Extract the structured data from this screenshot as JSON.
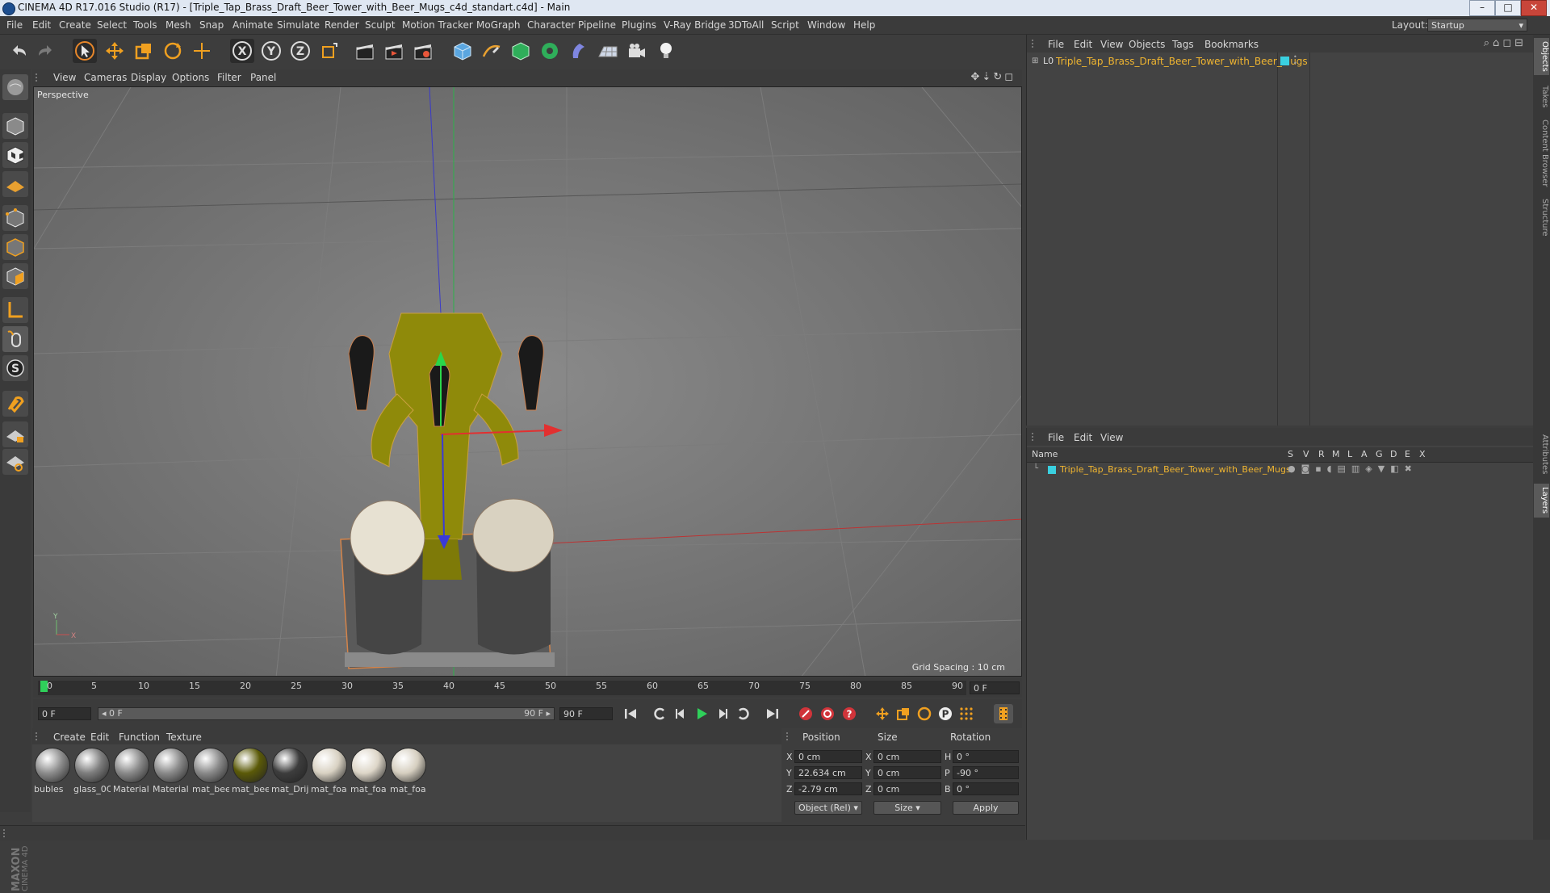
{
  "window": {
    "title": "CINEMA 4D R17.016 Studio (R17) - [Triple_Tap_Brass_Draft_Beer_Tower_with_Beer_Mugs_c4d_standart.c4d] - Main",
    "minimize": "–",
    "maximize": "□",
    "close": "✕"
  },
  "menubar": {
    "items": [
      "File",
      "Edit",
      "Create",
      "Select",
      "Tools",
      "Mesh",
      "Snap",
      "Animate",
      "Simulate",
      "Render",
      "Sculpt",
      "Motion Tracker",
      "MoGraph",
      "Character",
      "Pipeline",
      "Plugins",
      "V-Ray Bridge",
      "3DToAll",
      "Script",
      "Window",
      "Help"
    ],
    "layout_label": "Layout:",
    "layout_value": "Startup"
  },
  "viewport": {
    "menu": [
      "View",
      "Cameras",
      "Display",
      "Options",
      "Filter",
      "Panel"
    ],
    "label": "Perspective",
    "grid_spacing": "Grid Spacing : 10 cm"
  },
  "timeline": {
    "ticks": [
      "0",
      "5",
      "10",
      "15",
      "20",
      "25",
      "30",
      "35",
      "40",
      "45",
      "50",
      "55",
      "60",
      "65",
      "70",
      "75",
      "80",
      "85",
      "90"
    ],
    "current_frame": "0 F",
    "start_field": "0 F",
    "range_start": "◂ 0 F",
    "range_end": "90 F ▸",
    "end_field": "90 F"
  },
  "materials": {
    "menu": [
      "Create",
      "Edit",
      "Function",
      "Texture"
    ],
    "items": [
      {
        "label": "bubles",
        "color": "#8d8d8d"
      },
      {
        "label": "glass_0C",
        "color": "#7e7e7e"
      },
      {
        "label": "Material",
        "color": "#8a8a8a"
      },
      {
        "label": "Material",
        "color": "#8a8a8a"
      },
      {
        "label": "mat_bee",
        "color": "#8a8a8a"
      },
      {
        "label": "mat_bee",
        "color": "#5b5a08"
      },
      {
        "label": "mat_Drij",
        "color": "#3d3d3d"
      },
      {
        "label": "mat_foa",
        "color": "#d9d2c3"
      },
      {
        "label": "mat_foa",
        "color": "#ddd6c8"
      },
      {
        "label": "mat_foa",
        "color": "#d6cfc0"
      }
    ]
  },
  "coords": {
    "headers": {
      "position": "Position",
      "size": "Size",
      "rotation": "Rotation"
    },
    "rows": [
      {
        "axis": "X",
        "pos": "0 cm",
        "size_axis": "X",
        "size": "0 cm",
        "rot_axis": "H",
        "rot": "0 °"
      },
      {
        "axis": "Y",
        "pos": "22.634 cm",
        "size_axis": "Y",
        "size": "0 cm",
        "rot_axis": "P",
        "rot": "-90 °"
      },
      {
        "axis": "Z",
        "pos": "-2.79 cm",
        "size_axis": "Z",
        "size": "0 cm",
        "rot_axis": "B",
        "rot": "0 °"
      }
    ],
    "mode": "Object (Rel)",
    "size_mode": "Size",
    "apply": "Apply"
  },
  "objects": {
    "menu": [
      "File",
      "Edit",
      "View",
      "Objects",
      "Tags",
      "Bookmarks"
    ],
    "root_name": "Triple_Tap_Brass_Draft_Beer_Tower_with_Beer_Mugs"
  },
  "layers": {
    "menu": [
      "File",
      "Edit",
      "View"
    ],
    "columns": [
      "Name",
      "S",
      "V",
      "R",
      "M",
      "L",
      "A",
      "G",
      "D",
      "E",
      "X"
    ],
    "layer_name": "Triple_Tap_Brass_Draft_Beer_Tower_with_Beer_Mugs"
  },
  "right_tabs": [
    "Objects",
    "Takes",
    "Content Browser",
    "Structure",
    "Attributes",
    "Layers"
  ],
  "colors": {
    "accent": "#f0b530",
    "layer_color": "#3ad0e0",
    "brass": "#8f8a0a"
  }
}
